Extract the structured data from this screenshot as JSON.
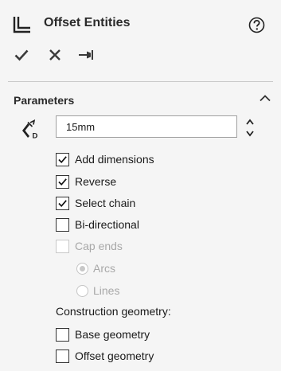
{
  "header": {
    "title": "Offset Entities",
    "help_icon": "help-icon",
    "title_icon": "offset-entities-icon"
  },
  "toolbar": {
    "ok_icon": "checkmark-icon",
    "cancel_icon": "close-icon",
    "pin_icon": "pushpin-icon"
  },
  "parameters": {
    "title": "Parameters",
    "distance_icon": "offset-distance-icon",
    "distance_value": "15mm",
    "options": [
      {
        "label": "Add dimensions",
        "checked": true,
        "enabled": true
      },
      {
        "label": "Reverse",
        "checked": true,
        "enabled": true
      },
      {
        "label": "Select chain",
        "checked": true,
        "enabled": true
      },
      {
        "label": "Bi-directional",
        "checked": false,
        "enabled": true
      },
      {
        "label": "Cap ends",
        "checked": false,
        "enabled": false
      }
    ],
    "cap_type": {
      "options": [
        "Arcs",
        "Lines"
      ],
      "selected": "Arcs",
      "enabled": false
    },
    "construction_label": "Construction geometry:",
    "construction_options": [
      {
        "label": "Base geometry",
        "checked": false
      },
      {
        "label": "Offset geometry",
        "checked": false
      }
    ]
  },
  "colors": {
    "panel_bg": "#f5f5f5",
    "text": "#1a1a1a",
    "disabled_text": "#a8a8a8",
    "divider": "#c9c9c9"
  }
}
